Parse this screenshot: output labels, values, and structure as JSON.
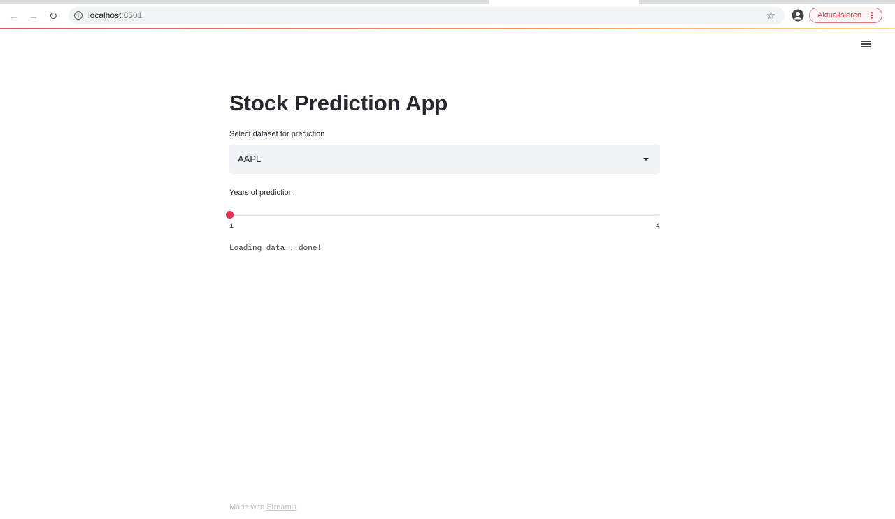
{
  "browser": {
    "url_host": "localhost",
    "url_port": ":8501",
    "update_button": "Aktualisieren",
    "icons": [
      "back-icon",
      "forward-icon",
      "reload-icon",
      "info-icon",
      "star-icon",
      "profile-icon",
      "kebab-icon"
    ]
  },
  "app": {
    "title": "Stock Prediction App",
    "menu_icon": "hamburger-icon",
    "accent_color": "#e0314d",
    "select": {
      "label": "Select dataset for prediction",
      "value": "AAPL"
    },
    "slider": {
      "label": "Years of prediction:",
      "min": "1",
      "max": "4",
      "value": 1
    },
    "status": "Loading data...done!",
    "footer": {
      "prefix": "Made with",
      "link": "Streamlit"
    }
  }
}
